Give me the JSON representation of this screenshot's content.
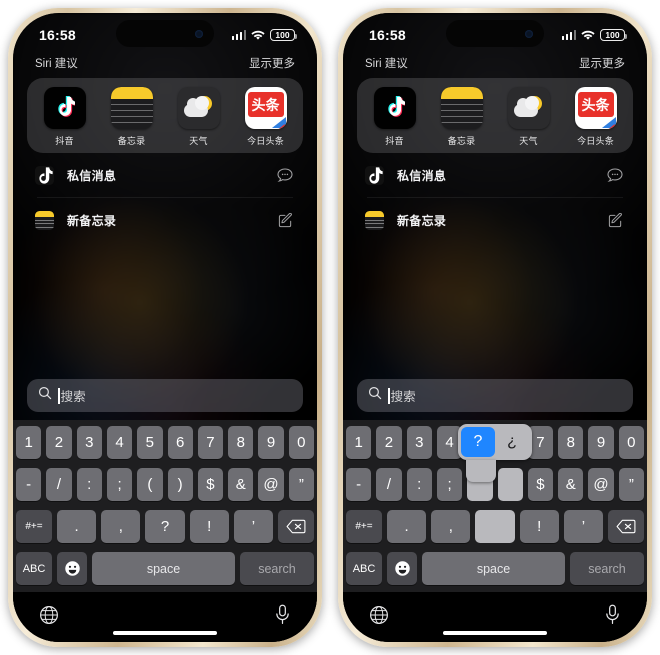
{
  "meta": {
    "device": "iPhone",
    "frame_color": "#d8c5a3",
    "accent_color": "#1f86ff",
    "keyboard_bg": "#1e1e20",
    "key_color": "#6e6e73",
    "key_dark_color": "#4a4a4f",
    "popup_color": "#b9b9bd"
  },
  "status_bar": {
    "time": "16:58",
    "battery_level": "100",
    "signal_icon": "cellular-signal-icon",
    "wifi_icon": "wifi-icon",
    "battery_icon": "battery-icon",
    "dynamic_island": "dynamic-island"
  },
  "siri": {
    "title": "Siri 建议",
    "show_more": "显示更多",
    "apps": [
      {
        "label": "抖音",
        "icon": "tiktok-icon"
      },
      {
        "label": "备忘录",
        "icon": "notes-icon"
      },
      {
        "label": "天气",
        "icon": "weather-icon"
      },
      {
        "label": "今日头条",
        "icon": "toutiao-icon",
        "glyph": "头条"
      }
    ],
    "actions": [
      {
        "label": "私信消息",
        "icon": "tiktok-icon",
        "action_icon": "message-bubble-icon"
      },
      {
        "label": "新备忘录",
        "icon": "notes-icon",
        "action_icon": "compose-icon"
      }
    ]
  },
  "search": {
    "placeholder": "搜索",
    "value": "",
    "icon": "search-icon"
  },
  "keyboard": {
    "row1": [
      "1",
      "2",
      "3",
      "4",
      "5",
      "6",
      "7",
      "8",
      "9",
      "0"
    ],
    "row2": [
      "-",
      "/",
      ":",
      ";",
      "(",
      ")",
      "$",
      "&",
      "@",
      "”"
    ],
    "row3_fn": "#+=",
    "row3": [
      ".",
      ",",
      "?",
      "!",
      "’"
    ],
    "row3_delete": "delete-icon",
    "row4": {
      "abc": "ABC",
      "emoji": "emoji-icon",
      "space": "space",
      "search": "search"
    }
  },
  "key_popup": {
    "visible_on": "right",
    "options": [
      "?",
      "¿"
    ],
    "selected": "?",
    "source_key": "?"
  },
  "bottom_bar": {
    "globe_icon": "globe-icon",
    "mic_icon": "microphone-icon",
    "home_indicator": "home-indicator"
  },
  "panels": [
    {
      "id": "left",
      "popup": false
    },
    {
      "id": "right",
      "popup": true
    }
  ]
}
